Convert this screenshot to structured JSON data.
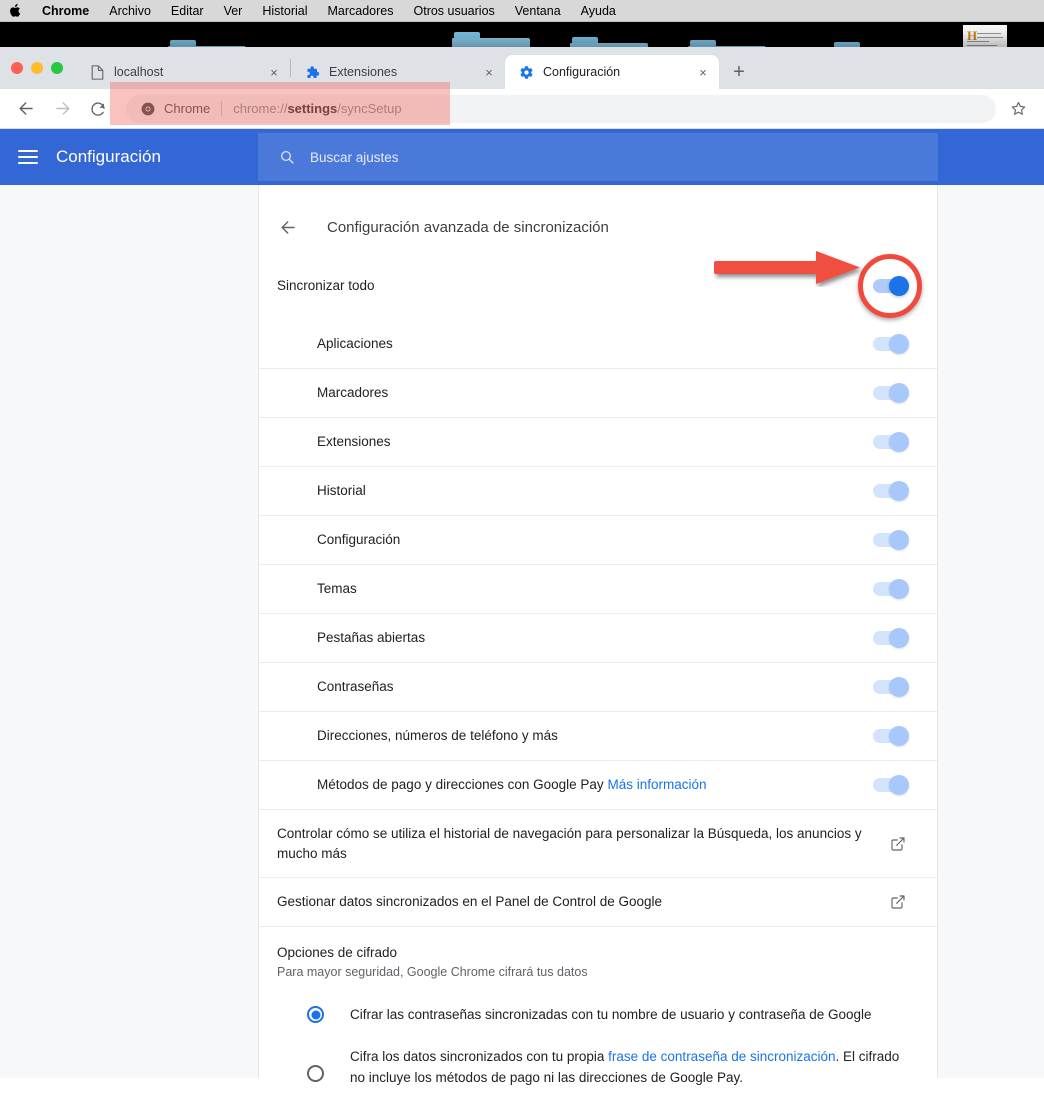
{
  "os_menubar": {
    "apple_icon": "apple-logo",
    "items": [
      {
        "label": "Chrome",
        "bold": true
      },
      {
        "label": "Archivo",
        "bold": false
      },
      {
        "label": "Editar",
        "bold": false
      },
      {
        "label": "Ver",
        "bold": false
      },
      {
        "label": "Historial",
        "bold": false
      },
      {
        "label": "Marcadores",
        "bold": false
      },
      {
        "label": "Otros usuarios",
        "bold": false
      },
      {
        "label": "Ventana",
        "bold": false
      },
      {
        "label": "Ayuda",
        "bold": false
      }
    ]
  },
  "browser": {
    "tabs": [
      {
        "title": "localhost",
        "favicon": "page-icon",
        "active": false,
        "close_label": "×"
      },
      {
        "title": "Extensiones",
        "favicon": "puzzle-icon",
        "active": false,
        "close_label": "×"
      },
      {
        "title": "Configuración",
        "favicon": "gear-icon",
        "active": true,
        "close_label": "×"
      }
    ],
    "new_tab_label": "+",
    "nav": {
      "back": "back-arrow-icon",
      "forward": "forward-arrow-icon",
      "reload": "reload-icon"
    },
    "omnibox": {
      "chrome_icon": "chrome-logo-icon",
      "scheme_label": "Chrome",
      "url_prefix": "chrome://",
      "url_bold": "settings",
      "url_suffix": "/syncSetup"
    },
    "bookmark_icon": "star-icon"
  },
  "settings_header": {
    "menu_icon": "hamburger-icon",
    "title": "Configuración",
    "search_icon": "search-icon",
    "search_placeholder": "Buscar ajustes"
  },
  "page": {
    "back_icon": "back-arrow-icon",
    "title": "Configuración avanzada de sincronización",
    "sync_all": {
      "label": "Sincronizar todo",
      "state": "on",
      "highlighted": true
    },
    "data_types": [
      {
        "label": "Aplicaciones",
        "state": "on"
      },
      {
        "label": "Marcadores",
        "state": "on"
      },
      {
        "label": "Extensiones",
        "state": "on"
      },
      {
        "label": "Historial",
        "state": "on"
      },
      {
        "label": "Configuración",
        "state": "on"
      },
      {
        "label": "Temas",
        "state": "on"
      },
      {
        "label": "Pestañas abiertas",
        "state": "on"
      },
      {
        "label": "Contraseñas",
        "state": "on"
      },
      {
        "label": "Direcciones, números de teléfono y más",
        "state": "on"
      }
    ],
    "google_pay_row": {
      "label": "Métodos de pago y direcciones con Google Pay",
      "link": "Más información",
      "state": "on"
    },
    "external_links": [
      {
        "label": "Controlar cómo se utiliza el historial de navegación para personalizar la Búsqueda, los anuncios y mucho más",
        "icon": "external-link-icon"
      },
      {
        "label": "Gestionar datos sincronizados en el Panel de Control de Google",
        "icon": "external-link-icon"
      }
    ],
    "encryption": {
      "title": "Opciones de cifrado",
      "subtitle": "Para mayor seguridad, Google Chrome cifrará tus datos",
      "options": [
        {
          "text": "Cifrar las contraseñas sincronizadas con tu nombre de usuario y contraseña de Google",
          "selected": true
        },
        {
          "text_before": "Cifra los datos sincronizados con tu propia ",
          "link": "frase de contraseña de sincronización",
          "text_after": ". El cifrado no incluye los métodos de pago ni las direcciones de Google Pay.",
          "selected": false
        }
      ]
    }
  },
  "annotations": {
    "arrow": {
      "name": "red-arrow-annotation",
      "color": "#f0503f"
    },
    "circle": {
      "name": "red-circle-annotation",
      "color": "#ef4a3c"
    },
    "url_highlight": {
      "name": "url-highlight-annotation",
      "color": "#f06e64"
    }
  },
  "colors": {
    "accent_blue": "#1a73e8",
    "header_blue": "#3367d6",
    "toggle_light": "#d2e3fc",
    "annotation_red": "#ef4a3c"
  }
}
